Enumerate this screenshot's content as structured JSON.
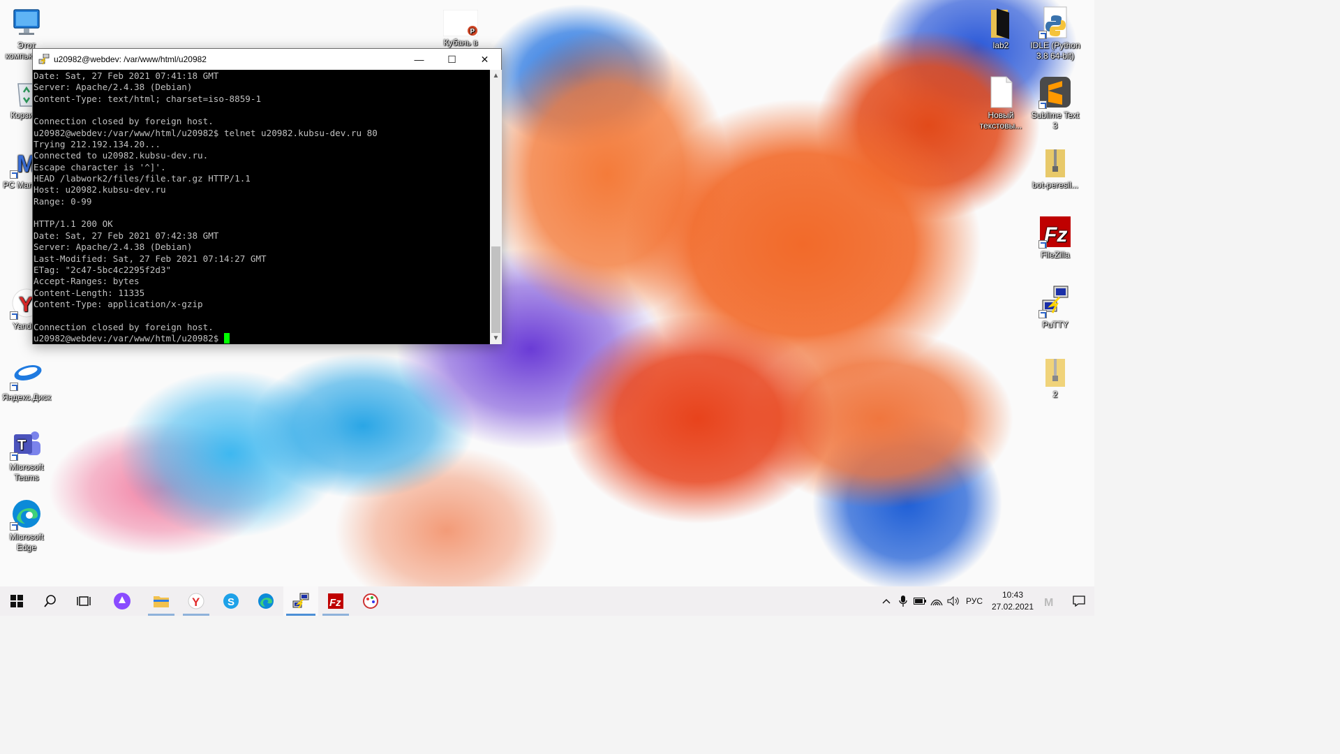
{
  "desktop": {
    "left_icons": [
      {
        "label": "Этот компьютер",
        "icon": "computer-icon"
      },
      {
        "label": "Корзина",
        "icon": "recycle-bin-icon"
      },
      {
        "label": "PC Manager",
        "icon": "pc-manager-icon"
      },
      {
        "label": "Yandex",
        "icon": "yandex-browser-icon"
      },
      {
        "label": "Яндекс.Диск",
        "icon": "yandex-disk-icon"
      },
      {
        "label": "Microsoft Teams",
        "icon": "teams-icon"
      },
      {
        "label": "Microsoft Edge",
        "icon": "edge-icon"
      }
    ],
    "top_icon": {
      "label": "Кубань в",
      "icon": "powerpoint-file-icon"
    },
    "right_icons": [
      {
        "label": "lab2",
        "icon": "folder-icon"
      },
      {
        "label": "IDLE (Python 3.8 64-bit)",
        "icon": "python-idle-icon"
      },
      {
        "label": "Новый текстовы...",
        "icon": "text-file-icon"
      },
      {
        "label": "Sublime Text 3",
        "icon": "sublime-text-icon"
      },
      {
        "label": "bot-peresil...",
        "icon": "zip-folder-icon"
      },
      {
        "label": "FileZilla",
        "icon": "filezilla-icon"
      },
      {
        "label": "PuTTY",
        "icon": "putty-icon"
      },
      {
        "label": "2",
        "icon": "zip-folder-icon"
      }
    ]
  },
  "window": {
    "title": "u20982@webdev: /var/www/html/u20982",
    "minimize": "—",
    "maximize": "☐",
    "close": "✕",
    "terminal_lines": [
      "Date: Sat, 27 Feb 2021 07:41:18 GMT",
      "Server: Apache/2.4.38 (Debian)",
      "Content-Type: text/html; charset=iso-8859-1",
      "",
      "Connection closed by foreign host.",
      "u20982@webdev:/var/www/html/u20982$ telnet u20982.kubsu-dev.ru 80",
      "Trying 212.192.134.20...",
      "Connected to u20982.kubsu-dev.ru.",
      "Escape character is '^]'.",
      "HEAD /labwork2/files/file.tar.gz HTTP/1.1",
      "Host: u20982.kubsu-dev.ru",
      "Range: 0-99",
      "",
      "HTTP/1.1 200 OK",
      "Date: Sat, 27 Feb 2021 07:42:38 GMT",
      "Server: Apache/2.4.38 (Debian)",
      "Last-Modified: Sat, 27 Feb 2021 07:14:27 GMT",
      "ETag: \"2c47-5bc4c2295f2d3\"",
      "Accept-Ranges: bytes",
      "Content-Length: 11335",
      "Content-Type: application/x-gzip",
      "",
      "Connection closed by foreign host."
    ],
    "prompt": "u20982@webdev:/var/www/html/u20982$ "
  },
  "taskbar": {
    "items": [
      {
        "name": "start-button",
        "icon": "windows-logo-icon"
      },
      {
        "name": "search-button",
        "icon": "search-icon"
      },
      {
        "name": "task-view-button",
        "icon": "task-view-icon"
      },
      {
        "name": "alice-button",
        "icon": "alice-icon"
      },
      {
        "name": "explorer-button",
        "icon": "folder-icon"
      },
      {
        "name": "yandex-button",
        "icon": "yandex-browser-icon"
      },
      {
        "name": "skype-button",
        "icon": "skype-icon"
      },
      {
        "name": "edge-button",
        "icon": "edge-icon"
      },
      {
        "name": "putty-button",
        "icon": "putty-icon"
      },
      {
        "name": "filezilla-button",
        "icon": "filezilla-icon"
      },
      {
        "name": "paint-button",
        "icon": "paint-icon"
      }
    ],
    "tray": {
      "language": "РУС",
      "time": "10:43",
      "date": "27.02.2021"
    }
  },
  "colors": {
    "terminal_bg": "#000000",
    "terminal_fg": "#c0c0c0",
    "cursor": "#00ff00",
    "accent": "#4c8fd6"
  }
}
